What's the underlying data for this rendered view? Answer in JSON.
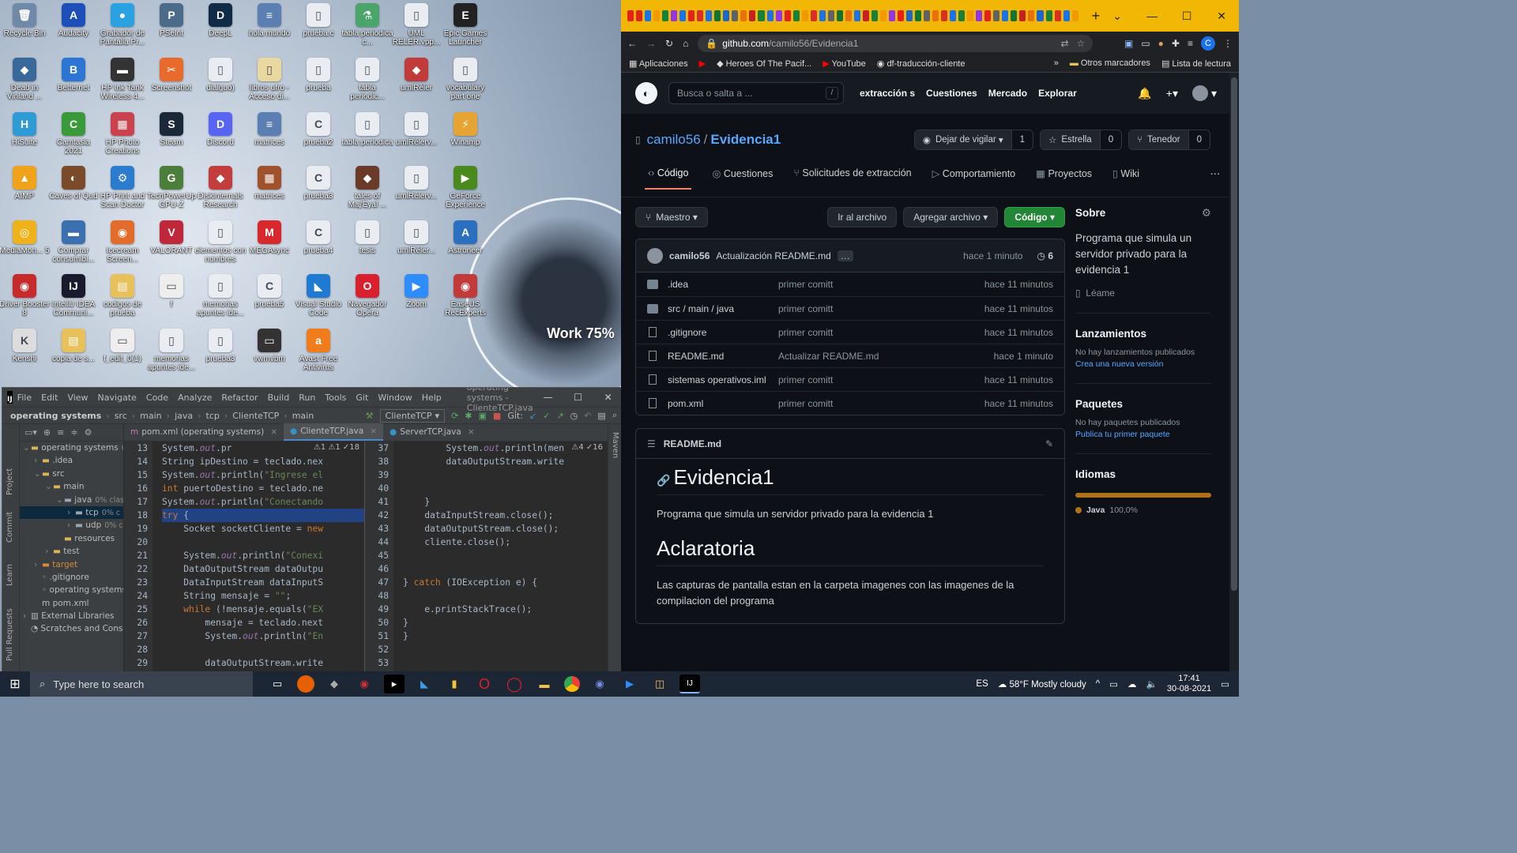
{
  "desktop": {
    "widget_label": "Work 75%",
    "icons": [
      {
        "label": "Recycle Bin",
        "glyph": "🗑",
        "color": "#6f8aa8"
      },
      {
        "label": "Audacity",
        "glyph": "A",
        "color": "#1d4fb8"
      },
      {
        "label": "Grabador de Pantalla Pr...",
        "glyph": "●",
        "color": "#2aa1e0"
      },
      {
        "label": "PSeInt",
        "glyph": "P",
        "color": "#4a6b8a"
      },
      {
        "label": "DeepL",
        "glyph": "D",
        "color": "#0f2b46"
      },
      {
        "label": "hola mundo",
        "glyph": "≡",
        "color": "#5b7fb3"
      },
      {
        "label": "prueba.c",
        "glyph": "▯",
        "color": "#e9edf2"
      },
      {
        "label": "tabla periodica c...",
        "glyph": "⚗",
        "color": "#4aa56b"
      },
      {
        "label": "UML RELER.vpp...",
        "glyph": "▯",
        "color": "#e9edf2"
      },
      {
        "label": "Epic Games Launcher",
        "glyph": "E",
        "color": "#222"
      },
      {
        "label": "Dead in Vinland ...",
        "glyph": "◆",
        "color": "#39689b"
      },
      {
        "label": "Betternet",
        "glyph": "B",
        "color": "#2b76d2"
      },
      {
        "label": "HP Ink Tank Wireless 4...",
        "glyph": "▬",
        "color": "#333"
      },
      {
        "label": "Screenshot",
        "glyph": "✂",
        "color": "#e86a2c"
      },
      {
        "label": "dialguo)",
        "glyph": "▯",
        "color": "#e9edf2"
      },
      {
        "label": "libros ufro - Acceso di...",
        "glyph": "▯",
        "color": "#e9d9a0"
      },
      {
        "label": "prueba",
        "glyph": "▯",
        "color": "#e9edf2"
      },
      {
        "label": "tabla periodic...",
        "glyph": "▯",
        "color": "#e9edf2"
      },
      {
        "label": "umlRéler",
        "glyph": "◆",
        "color": "#c23b3b"
      },
      {
        "label": "vocabulary part one",
        "glyph": "▯",
        "color": "#e9edf2"
      },
      {
        "label": "HiSuite",
        "glyph": "H",
        "color": "#2e9bd6"
      },
      {
        "label": "Camtasia 2021",
        "glyph": "C",
        "color": "#3a9a3a"
      },
      {
        "label": "HP Photo Creations",
        "glyph": "▦",
        "color": "#c9424e"
      },
      {
        "label": "Steam",
        "glyph": "S",
        "color": "#1b2838"
      },
      {
        "label": "Discord",
        "glyph": "D",
        "color": "#5865f2"
      },
      {
        "label": "matrices",
        "glyph": "≡",
        "color": "#5b7fb3"
      },
      {
        "label": "prueba2",
        "glyph": "C",
        "color": "#e9edf2"
      },
      {
        "label": "tabla periodica",
        "glyph": "▯",
        "color": "#e9edf2"
      },
      {
        "label": "umlRélerv...",
        "glyph": "▯",
        "color": "#e9edf2"
      },
      {
        "label": "Winamp",
        "glyph": "⚡",
        "color": "#e6a532"
      },
      {
        "label": "AIMP",
        "glyph": "▲",
        "color": "#f0a21b"
      },
      {
        "label": "Caves of Qud",
        "glyph": "◐",
        "color": "#7a4a2a"
      },
      {
        "label": "HP Print and Scan Doctor",
        "glyph": "⚙",
        "color": "#2b7bcf"
      },
      {
        "label": "TechPowerUp GPU-Z",
        "glyph": "G",
        "color": "#4b7d3b"
      },
      {
        "label": "Diskinternals Research",
        "glyph": "◆",
        "color": "#c43d3d"
      },
      {
        "label": "matrices",
        "glyph": "▦",
        "color": "#a0522d"
      },
      {
        "label": "prueba3",
        "glyph": "C",
        "color": "#e9edf2"
      },
      {
        "label": "tales of Maj'Eyal ...",
        "glyph": "◆",
        "color": "#6b3b2a"
      },
      {
        "label": "umlRélerv...",
        "glyph": "▯",
        "color": "#e9edf2"
      },
      {
        "label": "GeForce Experience",
        "glyph": "▶",
        "color": "#4a8a1c"
      },
      {
        "label": "MediaMon... 5",
        "glyph": "◎",
        "color": "#f0b21b"
      },
      {
        "label": "Comprar consumibl...",
        "glyph": "▬",
        "color": "#3a6fb0"
      },
      {
        "label": "Icecream Screen...",
        "glyph": "◉",
        "color": "#e36c2b"
      },
      {
        "label": "VALORANT",
        "glyph": "V",
        "color": "#c0273a"
      },
      {
        "label": "elementos con nombres",
        "glyph": "▯",
        "color": "#e9edf2"
      },
      {
        "label": "MEGAsync",
        "glyph": "M",
        "color": "#d9272e"
      },
      {
        "label": "prueba4",
        "glyph": "C",
        "color": "#e9edf2"
      },
      {
        "label": "tesis",
        "glyph": "▯",
        "color": "#e9edf2"
      },
      {
        "label": "umlRéler...",
        "glyph": "▯",
        "color": "#e9edf2"
      },
      {
        "label": "Astroneer",
        "glyph": "A",
        "color": "#2b6fc0"
      },
      {
        "label": "Driver Booster 8",
        "glyph": "◉",
        "color": "#c72a2a"
      },
      {
        "label": "IntelliJ IDEA Communi...",
        "glyph": "IJ",
        "color": "#1a1a2e"
      },
      {
        "label": "codigos de prueba",
        "glyph": "▤",
        "color": "#e8c15a"
      },
      {
        "label": "f",
        "glyph": "▭",
        "color": "#eee"
      },
      {
        "label": "memorias apuntes ide...",
        "glyph": "▯",
        "color": "#e9edf2"
      },
      {
        "label": "prueba5",
        "glyph": "C",
        "color": "#e9edf2"
      },
      {
        "label": "Visual Studio Code",
        "glyph": "◣",
        "color": "#1f7ad1"
      },
      {
        "label": "Navegador Opera",
        "glyph": "O",
        "color": "#d9202e"
      },
      {
        "label": "Zoom",
        "glyph": "▶",
        "color": "#2d8cff"
      },
      {
        "label": "EaseUS RecExperts",
        "glyph": "◉",
        "color": "#c23a3a"
      },
      {
        "label": "Kenshi",
        "glyph": "K",
        "color": "#ddd"
      },
      {
        "label": "copia de s...",
        "glyph": "▤",
        "color": "#e8c15a"
      },
      {
        "label": "f_edit_0(1)",
        "glyph": "▭",
        "color": "#eee"
      },
      {
        "label": "memorias apuntes ide...",
        "glyph": "▯",
        "color": "#e9edf2"
      },
      {
        "label": "prueba3",
        "glyph": "▯",
        "color": "#e9edf2"
      },
      {
        "label": "vwmvbm",
        "glyph": "▭",
        "color": "#333"
      },
      {
        "label": "Avast Free Antivirus",
        "glyph": "a",
        "color": "#f07c1b"
      }
    ]
  },
  "ide": {
    "logo": "IJ",
    "menu": [
      "File",
      "Edit",
      "View",
      "Navigate",
      "Code",
      "Analyze",
      "Refactor",
      "Build",
      "Run",
      "Tools",
      "Git",
      "Window",
      "Help"
    ],
    "window_title": "operating systems - ClienteTCP.java",
    "breadcrumb": [
      "operating systems",
      "src",
      "main",
      "java",
      "tcp",
      "ClienteTCP",
      "main"
    ],
    "run_config": "ClienteTCP",
    "git_label": "Git:",
    "side_tabs": [
      "Project",
      "Commit",
      "Learn",
      "Pull Requests"
    ],
    "right_tab": "Maven",
    "tabs": [
      {
        "label": "pom.xml (operating systems)",
        "active": false
      },
      {
        "label": "ClienteTCP.java",
        "active": true
      },
      {
        "label": "ServerTCP.java",
        "active": false
      }
    ],
    "tree": [
      {
        "indent": 0,
        "arrow": "⌄",
        "icon": "▬",
        "label": "operating systems",
        "extra": "C:\\",
        "cls": "fold"
      },
      {
        "indent": 1,
        "arrow": "›",
        "icon": "▬",
        "label": ".idea",
        "extra": "",
        "cls": "fold"
      },
      {
        "indent": 1,
        "arrow": "⌄",
        "icon": "▬",
        "label": "src",
        "extra": "",
        "cls": "fold"
      },
      {
        "indent": 2,
        "arrow": "⌄",
        "icon": "▬",
        "label": "main",
        "extra": "",
        "cls": "fold"
      },
      {
        "indent": 3,
        "arrow": "⌄",
        "icon": "▬",
        "label": "java",
        "extra": "0% clas",
        "cls": "pkg"
      },
      {
        "indent": 4,
        "arrow": "›",
        "icon": "▬",
        "label": "tcp",
        "extra": "0% c",
        "cls": "pkg",
        "sel": true
      },
      {
        "indent": 4,
        "arrow": "›",
        "icon": "▬",
        "label": "udp",
        "extra": "0% c",
        "cls": "pkg"
      },
      {
        "indent": 3,
        "arrow": "",
        "icon": "▬",
        "label": "resources",
        "extra": "",
        "cls": "fold"
      },
      {
        "indent": 2,
        "arrow": "›",
        "icon": "▬",
        "label": "test",
        "extra": "",
        "cls": "fold"
      },
      {
        "indent": 1,
        "arrow": "›",
        "icon": "▬",
        "label": "target",
        "extra": "",
        "cls": "target"
      },
      {
        "indent": 1,
        "arrow": "",
        "icon": "◦",
        "label": ".gitignore",
        "extra": "",
        "cls": ""
      },
      {
        "indent": 1,
        "arrow": "",
        "icon": "◦",
        "label": "operating systems.i",
        "extra": "",
        "cls": ""
      },
      {
        "indent": 1,
        "arrow": "",
        "icon": "m",
        "label": "pom.xml",
        "extra": "",
        "cls": ""
      },
      {
        "indent": 0,
        "arrow": "›",
        "icon": "▥",
        "label": "External Libraries",
        "extra": "",
        "cls": ""
      },
      {
        "indent": 0,
        "arrow": "",
        "icon": "◔",
        "label": "Scratches and Console",
        "extra": "",
        "cls": ""
      }
    ],
    "left_inspect": "⚠1 ⚠1 ✓18",
    "right_inspect": "⚠4 ✓16",
    "left_lines": [
      13,
      14,
      15,
      16,
      17,
      18,
      19,
      20,
      21,
      22,
      23,
      24,
      25,
      26,
      27,
      28,
      29
    ],
    "right_lines": [
      37,
      38,
      39,
      40,
      41,
      42,
      43,
      44,
      45,
      46,
      47,
      48,
      49,
      50,
      51,
      52,
      53
    ],
    "left_code": [
      "System.out.pr",
      "String ipDestino = teclado.nex",
      "System.out.println(\"Ingrese el",
      "int puertoDestino = teclado.ne",
      "System.out.println(\"Conectando",
      "try {",
      "    Socket socketCliente = new",
      "",
      "    System.out.println(\"Conexi",
      "    DataOutputStream dataOutpu",
      "    DataInputStream dataInputS",
      "    String mensaje = \"\";",
      "    while (!mensaje.equals(\"EX",
      "        mensaje = teclado.next",
      "        System.out.println(\"En",
      "",
      "        dataOutputStream.write"
    ],
    "right_code": [
      "        System.out.println(men",
      "        dataOutputStream.write",
      "",
      "",
      "    }",
      "    dataInputStream.close();",
      "    dataOutputStream.close();",
      "    cliente.close();",
      "",
      "",
      "} catch (IOException e) {",
      "",
      "    e.printStackTrace();",
      "}",
      "}",
      "",
      ""
    ]
  },
  "chrome": {
    "url_host": "github.com",
    "url_path": "/camilo56/Evidencia1",
    "profile_initial": "C",
    "bookmarks": [
      "Aplicaciones",
      "Heroes Of The Pacif...",
      "YouTube",
      "df-traducción-cliente"
    ],
    "bookmarks_right": [
      "Otros marcadores",
      "Lista de lectura"
    ]
  },
  "github": {
    "search_placeholder": "Busca o salta a ...",
    "search_key": "/",
    "nav": [
      "extracción s",
      "Cuestiones",
      "Mercado",
      "Explorar"
    ],
    "owner": "camilo56",
    "repo": "Evidencia1",
    "watch_label": "Dejar de vigilar",
    "watch_count": "1",
    "star_label": "Estrella",
    "star_count": "0",
    "fork_label": "Tenedor",
    "fork_count": "0",
    "tabs": [
      "Código",
      "Cuestiones",
      "Solicitudes de extracción",
      "Comportamiento",
      "Proyectos",
      "Wiki"
    ],
    "branch": "Maestro",
    "goto_file": "Ir al archivo",
    "add_file": "Agregar archivo",
    "code_btn": "Código",
    "commit_author": "camilo56",
    "commit_message": "Actualización README.md",
    "commit_time": "hace 1 minuto",
    "commit_count": "6",
    "files": [
      {
        "type": "dir",
        "name": ".idea",
        "msg": "primer comitt",
        "time": "hace 11 minutos"
      },
      {
        "type": "dir",
        "name": "src / main / java",
        "msg": "primer comitt",
        "time": "hace 11 minutos"
      },
      {
        "type": "file",
        "name": ".gitignore",
        "msg": "primer comitt",
        "time": "hace 11 minutos"
      },
      {
        "type": "file",
        "name": "README.md",
        "msg": "Actualizar README.md",
        "time": "hace 1 minuto"
      },
      {
        "type": "file",
        "name": "sistemas operativos.iml",
        "msg": "primer comitt",
        "time": "hace 11 minutos"
      },
      {
        "type": "file",
        "name": "pom.xml",
        "msg": "primer comitt",
        "time": "hace 11 minutos"
      }
    ],
    "readme": {
      "filename": "README.md",
      "h1": "Evidencia1",
      "p1": "Programa que simula un servidor privado para la evidencia 1",
      "h2": "Aclaratoria",
      "p2": "Las capturas de pantalla estan en la carpeta imagenes con las imagenes de la compilacion del programa"
    },
    "about": {
      "title": "Sobre",
      "desc": "Programa que simula un servidor privado para la evidencia 1",
      "readme_link": "Léame"
    },
    "releases": {
      "title": "Lanzamientos",
      "none": "No hay lanzamientos publicados",
      "link": "Crea una nueva versión"
    },
    "packages": {
      "title": "Paquetes",
      "none": "No hay paquetes publicados",
      "link": "Publica tu primer paquete"
    },
    "languages": {
      "title": "Idiomas",
      "name": "Java",
      "pct": "100,0%"
    }
  },
  "taskbar": {
    "search_placeholder": "Type here to search",
    "lang": "ES",
    "weather": "58°F  Mostly cloudy",
    "time": "17:41",
    "date": "30-08-2021"
  }
}
